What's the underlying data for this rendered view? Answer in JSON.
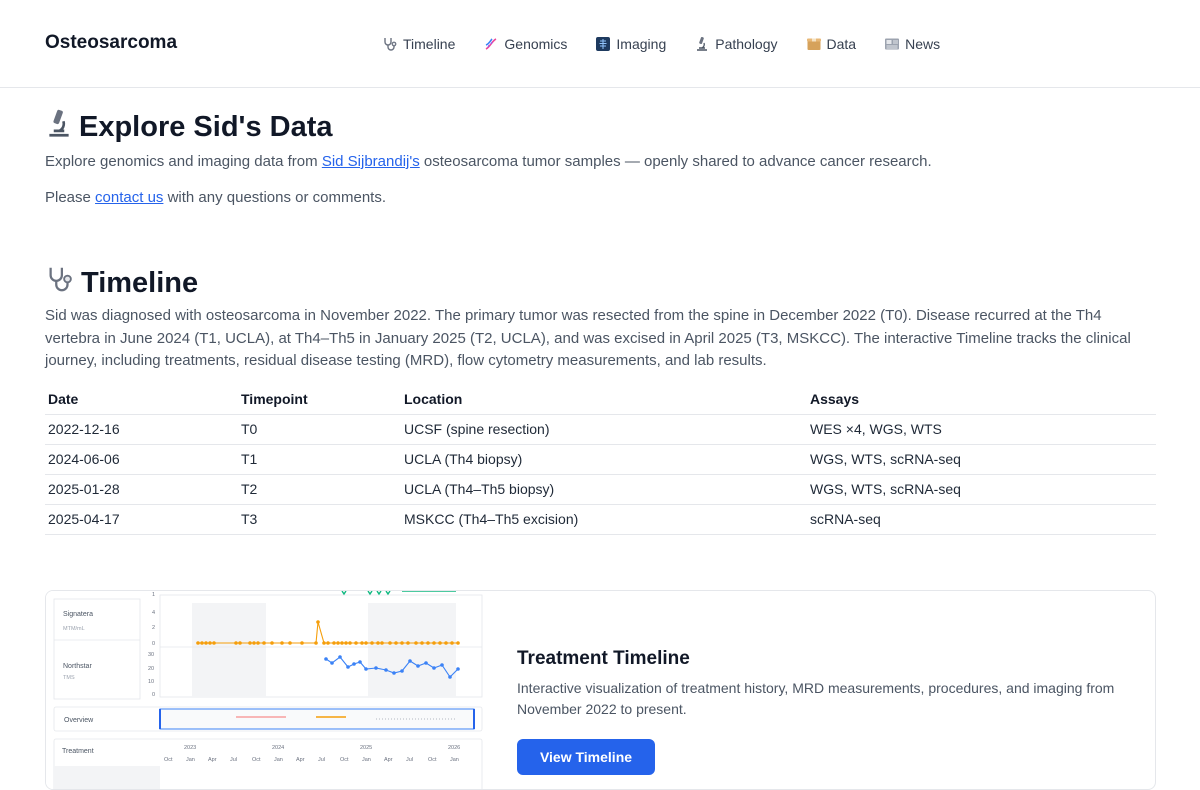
{
  "header": {
    "brand": "Osteosarcoma",
    "nav": [
      {
        "label": "Timeline",
        "icon": "stethoscope-icon"
      },
      {
        "label": "Genomics",
        "icon": "dna-icon"
      },
      {
        "label": "Imaging",
        "icon": "xray-icon"
      },
      {
        "label": "Pathology",
        "icon": "microscope-icon"
      },
      {
        "label": "Data",
        "icon": "box-icon"
      },
      {
        "label": "News",
        "icon": "newspaper-icon"
      }
    ]
  },
  "explore": {
    "title": "Explore Sid's Data",
    "intro_before": "Explore genomics and imaging data from ",
    "intro_link": "Sid Sijbrandij's",
    "intro_after": " osteosarcoma tumor samples — openly shared to advance cancer research.",
    "contact_before": "Please ",
    "contact_link": "contact us",
    "contact_after": " with any questions or comments."
  },
  "timeline": {
    "title": "Timeline",
    "description": "Sid was diagnosed with osteosarcoma in November 2022. The primary tumor was resected from the spine in December 2022 (T0). Disease recurred at the Th4 vertebra in June 2024 (T1, UCLA), at Th4–Th5 in January 2025 (T2, UCLA), and was excised in April 2025 (T3, MSKCC). The interactive Timeline tracks the clinical journey, including treatments, residual disease testing (MRD), flow cytometry measurements, and lab results.",
    "columns": [
      "Date",
      "Timepoint",
      "Location",
      "Assays"
    ],
    "rows": [
      [
        "2022-12-16",
        "T0",
        "UCSF (spine resection)",
        "WES ×4, WGS, WTS"
      ],
      [
        "2024-06-06",
        "T1",
        "UCLA (Th4 biopsy)",
        "WGS, WTS, scRNA-seq"
      ],
      [
        "2025-01-28",
        "T2",
        "UCLA (Th4–Th5 biopsy)",
        "WGS, WTS, scRNA-seq"
      ],
      [
        "2025-04-17",
        "T3",
        "MSKCC (Th4–Th5 excision)",
        "scRNA-seq"
      ]
    ]
  },
  "card": {
    "title": "Treatment Timeline",
    "description": "Interactive visualization of treatment history, MRD measurements, procedures, and imaging from November 2022 to present.",
    "button": "View Timeline",
    "accent": "#2563eb",
    "preview": {
      "signatera_label": "Signatera",
      "signatera_unit": "MTM/mL",
      "signatera_ticks": [
        "4",
        "2",
        "0"
      ],
      "northstar_label": "Northstar",
      "northstar_unit": "TMS",
      "northstar_ticks": [
        "30",
        "20",
        "10",
        "0"
      ],
      "top_tick": "1",
      "overview_label": "Overview",
      "treatment_label": "Treatment",
      "years": [
        "2023",
        "2024",
        "2025",
        "2026"
      ],
      "months": [
        "Oct",
        "Jan",
        "Apr",
        "Jul",
        "Oct",
        "Jan",
        "Apr",
        "Jul",
        "Oct",
        "Jan",
        "Apr",
        "Jul",
        "Oct",
        "Jan"
      ],
      "signatera_color": "#f59e0b",
      "northstar_color": "#3b82f6",
      "marker_color": "#10b981"
    }
  }
}
